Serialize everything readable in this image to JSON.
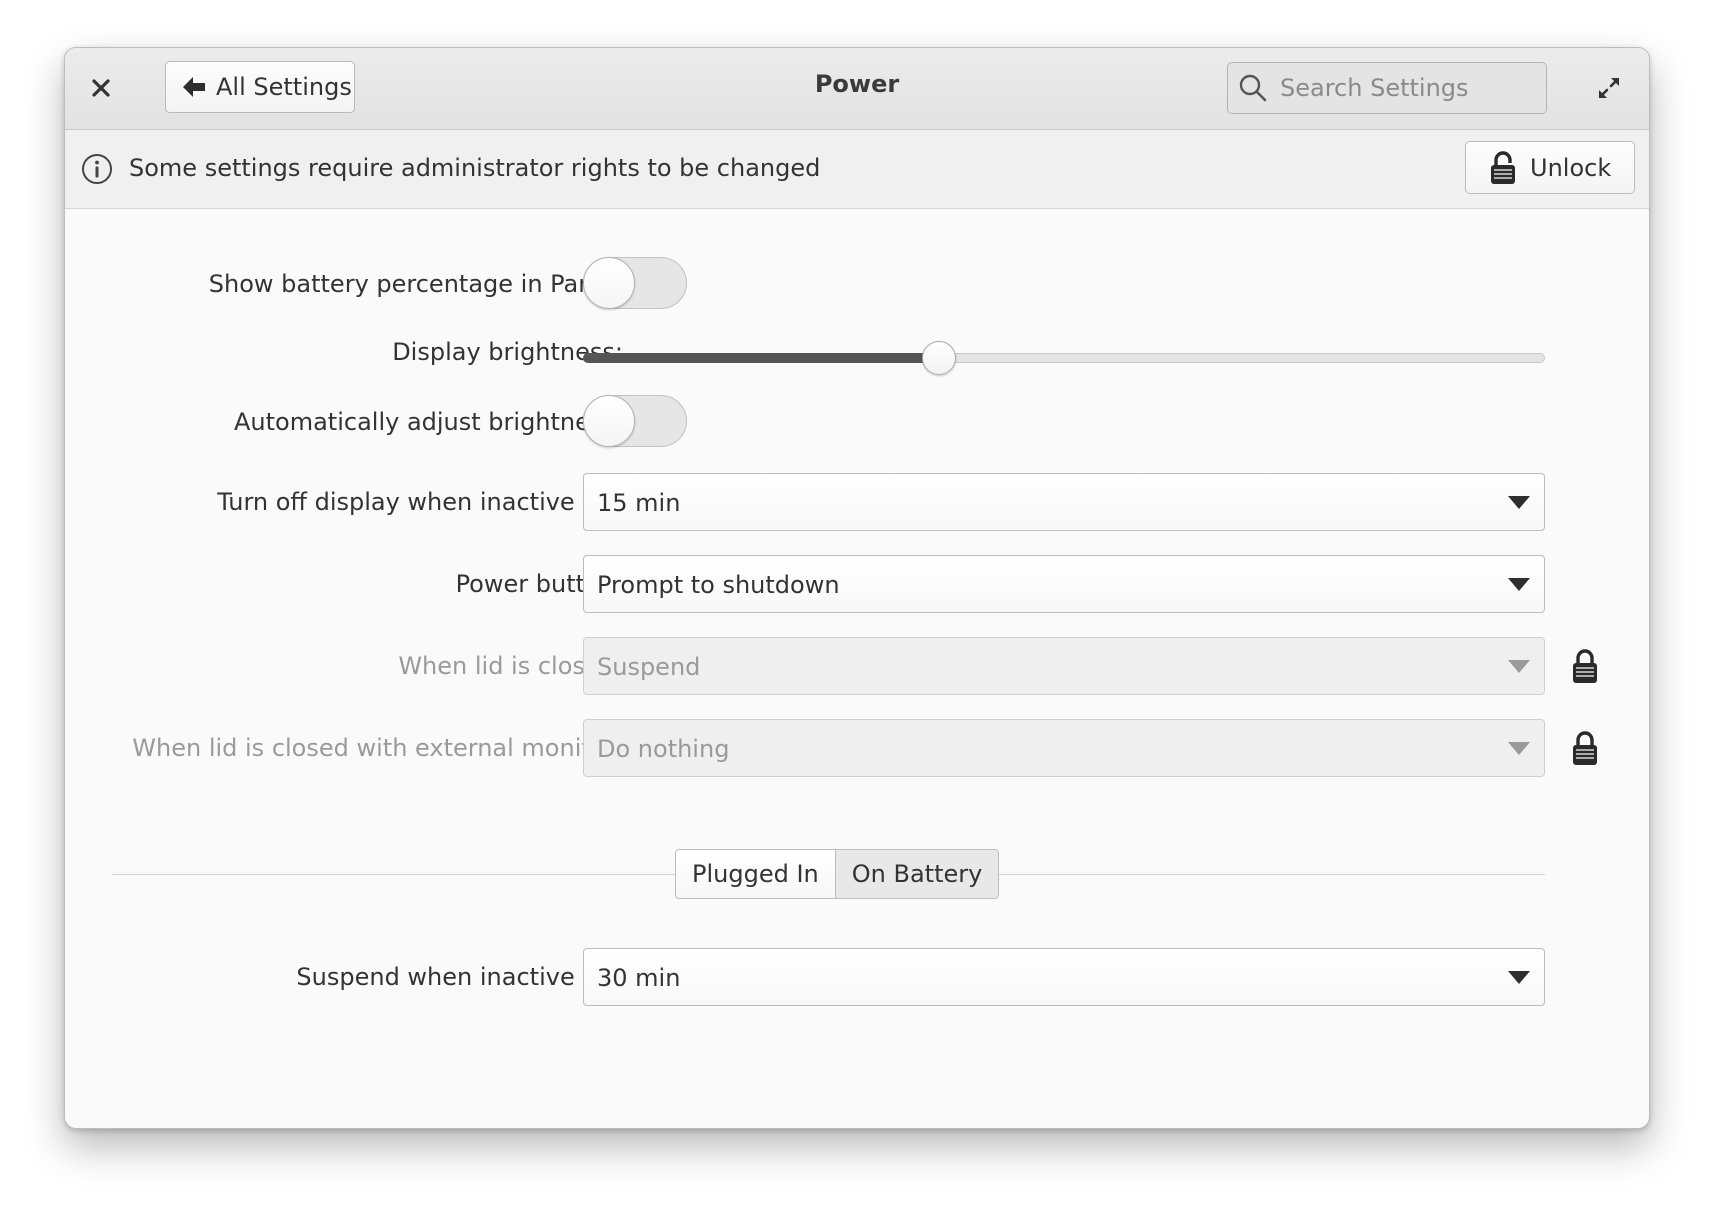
{
  "window": {
    "title": "Power"
  },
  "header": {
    "back_label": "All Settings",
    "search_placeholder": "Search Settings"
  },
  "infobar": {
    "message": "Some settings require administrator rights to be changed",
    "unlock_label": "Unlock"
  },
  "settings": {
    "battery_percentage": {
      "label": "Show battery percentage in Panel:",
      "enabled": false
    },
    "brightness": {
      "label": "Display brightness:",
      "level": 0.37
    },
    "auto_brightness": {
      "label": "Automatically adjust brightness:",
      "enabled": false
    },
    "display_off": {
      "label": "Turn off display when inactive for:",
      "value": "15 min"
    },
    "power_button": {
      "label": "Power button:",
      "value": "Prompt to shutdown"
    },
    "lid_closed": {
      "label": "When lid is closed:",
      "value": "Suspend",
      "locked": true
    },
    "lid_closed_external": {
      "label": "When lid is closed with external monitor:",
      "value": "Do nothing",
      "locked": true
    }
  },
  "mode_switch": {
    "options": [
      "Plugged In",
      "On Battery"
    ],
    "selected": "Plugged In"
  },
  "plugged_in": {
    "suspend": {
      "label": "Suspend when inactive for:",
      "value": "30 min"
    }
  },
  "icons": {
    "close": "close-icon",
    "back": "arrow-left-icon",
    "search": "search-icon",
    "maximize": "maximize-icon",
    "info": "info-icon",
    "lock": "lock-icon"
  }
}
